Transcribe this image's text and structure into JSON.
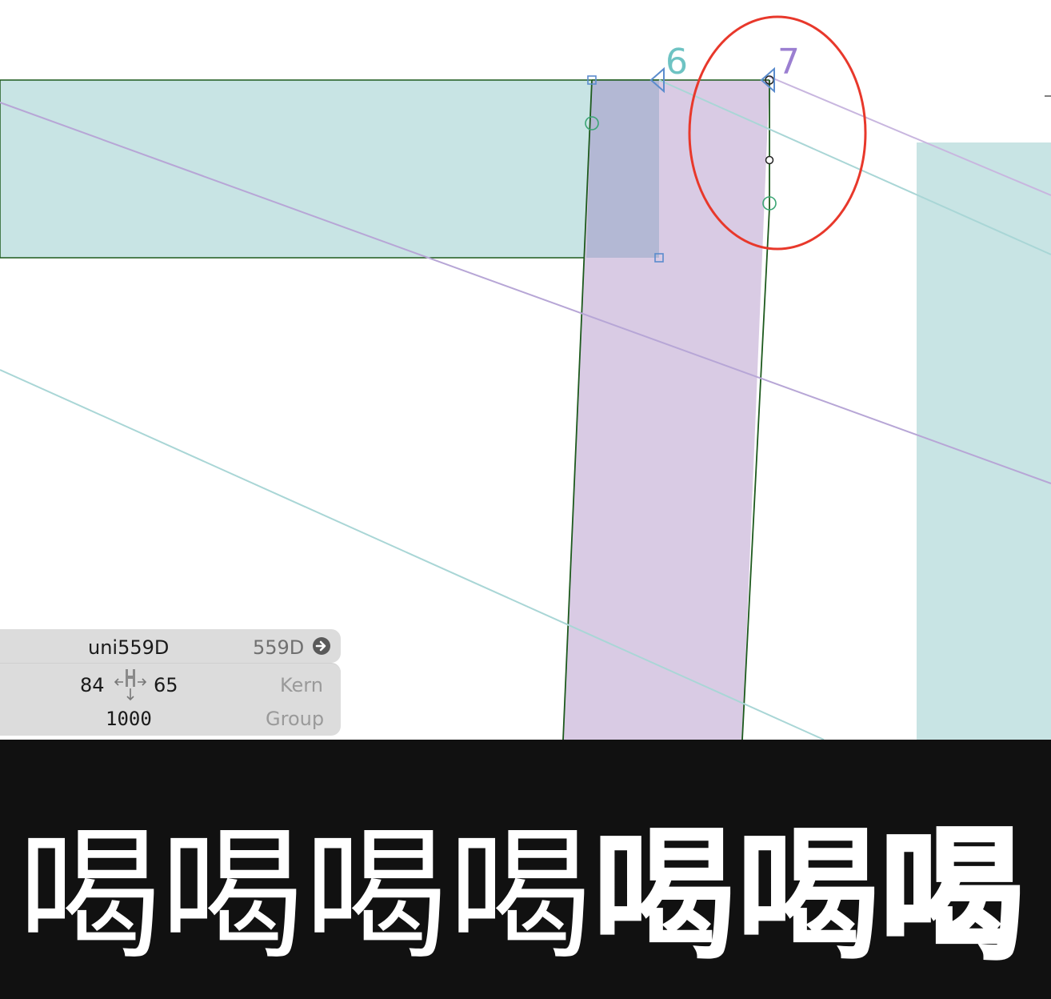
{
  "canvas": {
    "node_labels": {
      "left": "6",
      "right": "7"
    },
    "colors": {
      "teal_fill": "#c8e4e4",
      "purple_fill": "#d9cbe4",
      "overlap_fill": "#b3b8d4",
      "outline": "#1d5a1d",
      "node_blue": "#5b8ccd",
      "highlight_ellipse": "#e8382b"
    }
  },
  "info": {
    "glyph_name": "uni559D",
    "unicode": "559D",
    "left_sidebearing": "84",
    "right_sidebearing": "65",
    "width": "1000",
    "kern_label": "Kern",
    "group_label": "Group"
  },
  "preview": {
    "glyphs": [
      "喝",
      "喝",
      "喝",
      "喝",
      "喝",
      "喝",
      "喝"
    ],
    "background": "#111111"
  }
}
